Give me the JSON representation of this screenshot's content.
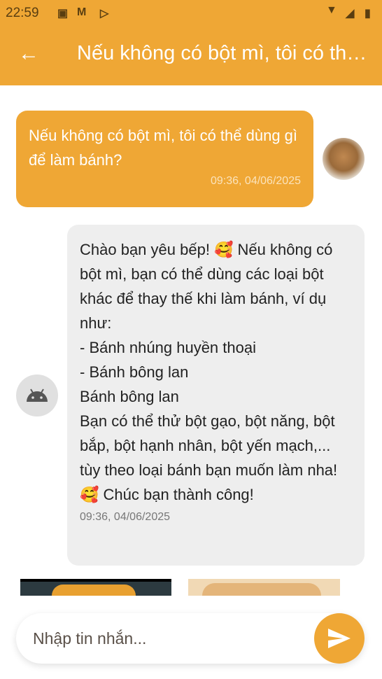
{
  "status_bar": {
    "time": "22:59"
  },
  "app_bar": {
    "title": "Nếu không có bột mì, tôi có thể dùng gì để làm bánh?"
  },
  "messages": [
    {
      "sender": "user",
      "text": "Nếu không có bột mì, tôi có thể dùng gì để làm bánh?",
      "timestamp": "09:36, 04/06/2025"
    },
    {
      "sender": "bot",
      "text": "Chào bạn yêu bếp! 🥰 Nếu không có bột mì, bạn có thể dùng các loại bột khác để thay thế khi làm bánh, ví dụ như:\n- Bánh nhúng huyền thoại\n- Bánh bông lan\nBánh bông lan\nBạn có thể thử bột gạo, bột năng, bột bắp, bột hạnh nhân, bột yến mạch,... tùy theo loại bánh bạn muốn làm nha! 🥰 Chúc bạn thành công!",
      "timestamp": "09:36, 04/06/2025"
    }
  ],
  "input": {
    "placeholder": "Nhập tin nhắn..."
  },
  "colors": {
    "accent": "#EFA735",
    "bot_bubble": "#EEEEEE"
  }
}
